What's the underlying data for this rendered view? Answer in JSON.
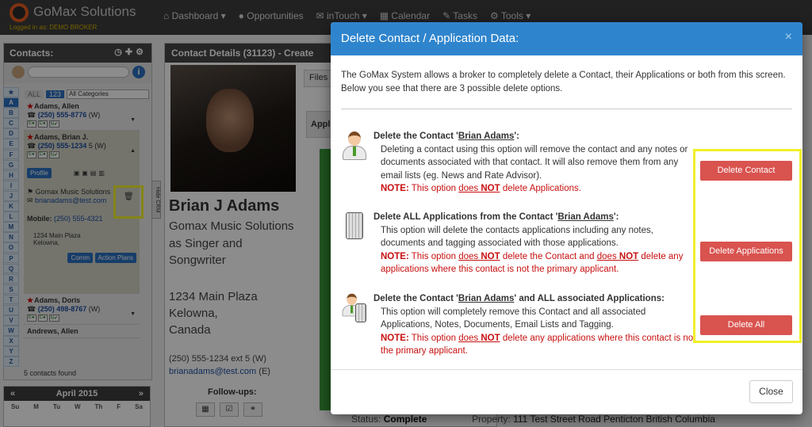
{
  "app": {
    "brand": "GoMax Solutions",
    "logged_in": "Logged in as: DEMO BROKER",
    "nav": [
      "Dashboard ▾",
      "Opportunities",
      "inTouch ▾",
      "Calendar",
      "Tasks",
      "Tools ▾"
    ]
  },
  "contacts_panel": {
    "title": "Contacts:",
    "tabs": [
      "ALL",
      "123"
    ],
    "category": "All Categories",
    "letters": [
      "★",
      "A",
      "B",
      "C",
      "D",
      "E",
      "F",
      "G",
      "H",
      "I",
      "J",
      "K",
      "L",
      "M",
      "N",
      "O",
      "P",
      "Q",
      "R",
      "S",
      "T",
      "U",
      "V",
      "W",
      "X",
      "Y",
      "Z"
    ],
    "contacts": [
      {
        "name": "Adams, Allen",
        "phone": "(250) 555-8776",
        "type": "(W)"
      },
      {
        "name": "Adams, Brian J.",
        "phone": "(250) 555-1234",
        "type": "5 (W)"
      },
      {
        "name": "Adams, Doris",
        "phone": "(250) 498-8767",
        "type": "(W)"
      },
      {
        "name": "Andrews, Allen",
        "phone": "",
        "type": ""
      }
    ],
    "chips": [
      "E●",
      "C●",
      "N✔"
    ],
    "expanded": {
      "profile": "Profile",
      "company": "Gomax Music Solutions",
      "email": "brianadams@test.com",
      "mobile_label": "Mobile:",
      "mobile": "(250) 555-4321",
      "addr1": "1234 Main Plaza",
      "addr2": "Kelowna,",
      "comm": "Comm",
      "action_plans": "Action Plans"
    },
    "found": "5 contacts found",
    "hide_crm": "Hide CRM"
  },
  "calendar": {
    "month": "April 2015",
    "prev": "«",
    "next": "»",
    "days": [
      "Su",
      "M",
      "Tu",
      "W",
      "Th",
      "F",
      "Sa"
    ]
  },
  "details": {
    "header": "Contact Details (31123) - Create",
    "name": "Brian J Adams",
    "company": "Gomax Music Solutions",
    "role1": "as Singer and",
    "role2": "Songwriter",
    "addr1": "1234 Main Plaza",
    "addr2": "Kelowna,",
    "addr3": "Canada",
    "phone": "(250) 555-1234 ext 5 (W)",
    "email": "brianadams@test.com",
    "email_suffix": "(E)",
    "followups": "Follow-ups:",
    "files_tab": "Files",
    "appl_tab": "Appl",
    "status_label": "Status:",
    "status_value": "Complete",
    "property_label": "Property:",
    "property_value": "111 Test Street Road Penticton British Columbia"
  },
  "modal": {
    "title": "Delete Contact / Application Data:",
    "close_x": "×",
    "intro": "The GoMax System allows a broker to completely delete a Contact, their Applications or both from this screen. Below you see that there are 3 possible delete options.",
    "contact_name": "Brian Adams",
    "opt1": {
      "title_pre": "Delete the Contact '",
      "title_post": "':",
      "body": "Deleting a contact using this option will remove the contact and any notes or documents associated with that contact. It will also remove them from any email lists (eg. News and Rate Advisor).",
      "note_label": "NOTE:",
      "note_a": " This option ",
      "note_b": "does ",
      "note_c": "NOT",
      "note_d": " delete Applications.",
      "button": "Delete Contact"
    },
    "opt2": {
      "title_pre": "Delete ALL Applications from the Contact '",
      "title_post": "':",
      "body": "This option will delete the contacts applications including any notes, documents and tagging associated with those applications.",
      "note_label": "NOTE:",
      "note_a": " This option ",
      "note_b": "does ",
      "note_c": "NOT",
      "note_d": " delete the Contact and ",
      "note_e": "does ",
      "note_f": "NOT",
      "note_g": " delete any applications where this contact is not the primary applicant.",
      "button": "Delete Applications"
    },
    "opt3": {
      "title_pre": "Delete the Contact '",
      "title_post": "' and ALL associated Applications:",
      "body": "This option will completely remove this Contact and all associated Applications, Notes, Documents, Email Lists and Tagging.",
      "note_label": "NOTE:",
      "note_a": " This option ",
      "note_b": "does ",
      "note_c": "NOT",
      "note_d": " delete any applications where this contact is not the primary applicant.",
      "button": "Delete All"
    },
    "close_button": "Close"
  },
  "colors": {
    "primary": "#2f85cd",
    "danger": "#d9534f",
    "highlight": "#f0f02a",
    "note": "#c81010"
  }
}
